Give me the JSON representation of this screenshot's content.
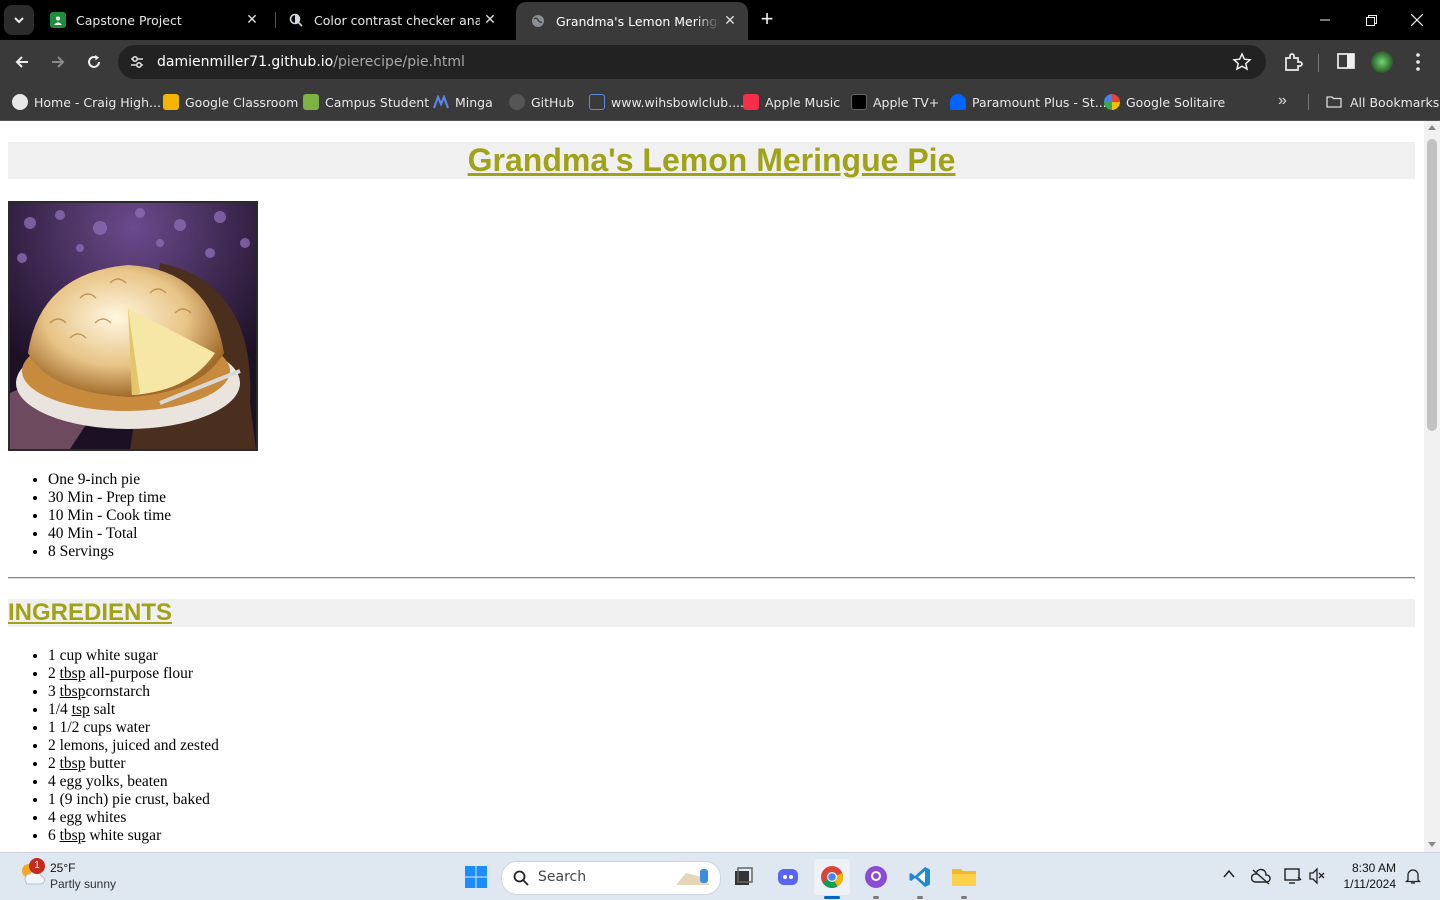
{
  "browser": {
    "tabs": [
      {
        "title": "Capstone Project",
        "icon": "classroom-icon",
        "color": "#1e8e3e"
      },
      {
        "title": "Color contrast checker analyzer",
        "icon": "contrast-checker-icon",
        "color": "#4a90d9"
      },
      {
        "title": "Grandma's Lemon Meringue Pie",
        "icon": "globe-icon",
        "color": "#9aa0a6"
      }
    ],
    "address": {
      "host": "damienmiller71.github.io",
      "path": "/pierecipe/pie.html"
    },
    "bookmarks": [
      {
        "label": "Home - Craig High...",
        "icon": "globe-icon",
        "color": "#e8e8e8"
      },
      {
        "label": "Google Classroom",
        "icon": "classroom-icon",
        "color": "#f4b400"
      },
      {
        "label": "Campus Student",
        "icon": "campus-icon",
        "color": "#7cb342"
      },
      {
        "label": "Minga",
        "icon": "minga-icon",
        "color": "#3f6bd6"
      },
      {
        "label": "GitHub",
        "icon": "github-icon",
        "color": "#555555"
      },
      {
        "label": "www.wihsbowlclub....",
        "icon": "bowlclub-icon",
        "color": "#5b8dd6"
      },
      {
        "label": "Apple Music",
        "icon": "apple-music-icon",
        "color": "#fa2d48"
      },
      {
        "label": "Apple TV+",
        "icon": "apple-tv-icon",
        "color": "#000000"
      },
      {
        "label": "Paramount Plus - St...",
        "icon": "paramount-icon",
        "color": "#0064ff"
      },
      {
        "label": "Google Solitaire",
        "icon": "google-icon",
        "color": "#4285f4"
      }
    ],
    "all_bookmarks": "All Bookmarks"
  },
  "page": {
    "title": "Grandma's Lemon Meringue Pie",
    "facts": [
      "One 9-inch pie",
      "30 Min - Prep time",
      "10 Min - Cook time",
      "40 Min - Total",
      "8 Servings"
    ],
    "ingredients_heading": "INGREDIENTS",
    "ingredients": [
      {
        "qty": "1",
        "unit": "",
        "text": "cup white sugar"
      },
      {
        "qty": "2",
        "unit": "tbsp",
        "text": "all-purpose flour"
      },
      {
        "qty": "3",
        "unit": "tbsp",
        "text": "cornstarch",
        "nospace": true
      },
      {
        "qty": "1/4",
        "unit": "tsp",
        "text": "salt"
      },
      {
        "qty": "1 1/2",
        "unit": "",
        "text": "cups water"
      },
      {
        "qty": "2",
        "unit": "",
        "text": "lemons, juiced and zested"
      },
      {
        "qty": "2",
        "unit": "tbsp",
        "text": "butter"
      },
      {
        "qty": "4",
        "unit": "",
        "text": "egg yolks, beaten"
      },
      {
        "qty": "1",
        "unit": "",
        "text": "(9 inch) pie crust, baked"
      },
      {
        "qty": "4",
        "unit": "",
        "text": "egg whites"
      },
      {
        "qty": "6",
        "unit": "tbsp",
        "text": "white sugar"
      }
    ],
    "heading_color": "#a0a31a"
  },
  "taskbar": {
    "weather_temp": "25°F",
    "weather_desc": "Partly sunny",
    "weather_badge": "1",
    "search_label": "Search",
    "time": "8:30 AM",
    "date": "1/11/2024"
  }
}
